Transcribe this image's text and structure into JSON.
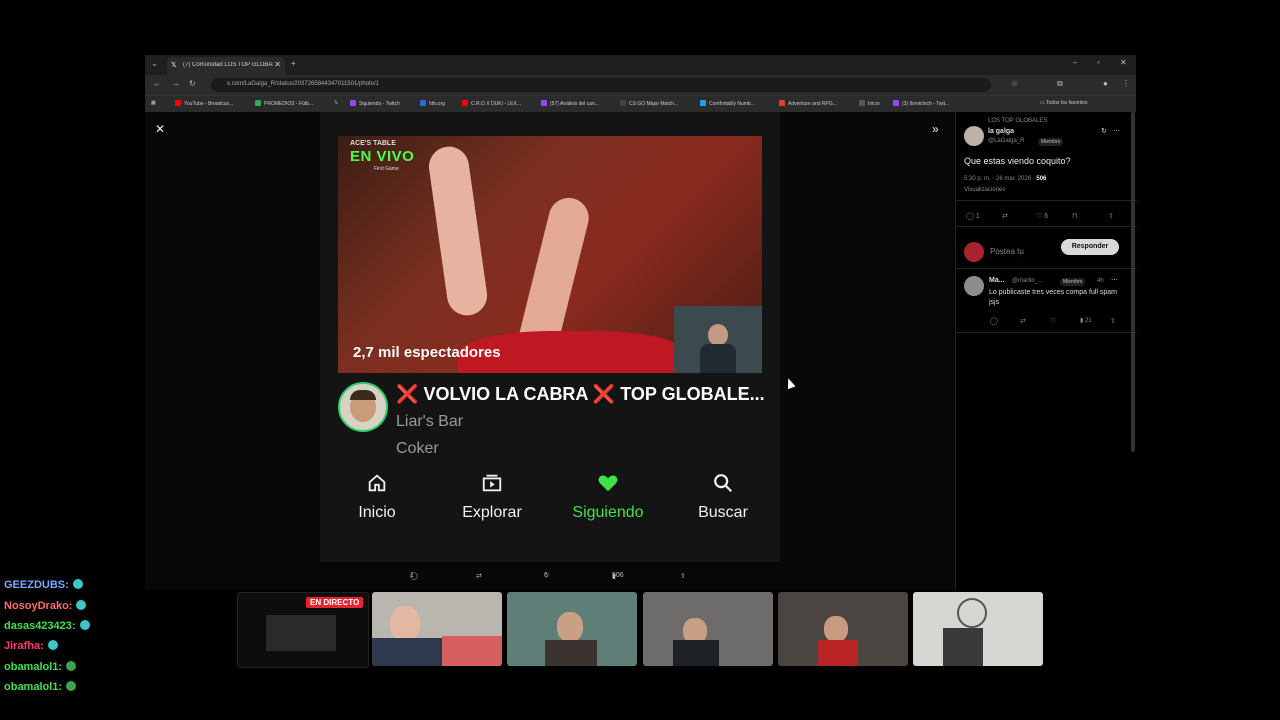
{
  "browser": {
    "tab_title": "(7) Comunidad LOS TOP GLOBALES",
    "url": "x.com/LaGalga_R/status/2037265844347011501/photo/1",
    "window_controls": [
      "–",
      "▫",
      "✕"
    ],
    "bookmarks": [
      {
        "label": "YouTube - Broadcas...",
        "color": "#ff0000"
      },
      {
        "label": "PROMEDIOS - Fútb...",
        "color": "#34a853"
      },
      {
        "label": "𝕏",
        "color": "#000000"
      },
      {
        "label": "Siguiendo - Twitch",
        "color": "#9146ff"
      },
      {
        "label": "hltv.org",
        "color": "#2d6bd6"
      },
      {
        "label": "C.R.O X DUKI - LEX...",
        "color": "#ff0000"
      },
      {
        "label": "(57) Análisis del can...",
        "color": "#9146ff"
      },
      {
        "label": "CS:GO Major Match...",
        "color": "#444444"
      },
      {
        "label": "Comfortably Numb...",
        "color": "#1da1f2"
      },
      {
        "label": "Adventure and RPG...",
        "color": "#e63b2e"
      },
      {
        "label": "Inicio",
        "color": "#000000"
      },
      {
        "label": "(3) Ilorvichich - Twit...",
        "color": "#9146ff"
      }
    ],
    "all_bookmarks": "Todos los favoritos"
  },
  "modal": {
    "close_icon": "✕",
    "next_icon": "»"
  },
  "stream_card": {
    "overlay_title": "ACE'S TABLE",
    "overlay_sub": "First Game",
    "live_label": "EN VIVO",
    "viewers": "2,7 mil espectadores",
    "title_x": "❌",
    "title_text": "VOLVIO LA CABRA",
    "title_text2": "TOP GLOBALE...",
    "game": "Liar's Bar",
    "streamer": "Coker",
    "nav": [
      {
        "label": "Inicio",
        "icon": "home-icon"
      },
      {
        "label": "Explorar",
        "icon": "browse-icon"
      },
      {
        "label": "Siguiendo",
        "icon": "heart-icon"
      },
      {
        "label": "Buscar",
        "icon": "search-icon"
      }
    ],
    "accent": "#3ee24a"
  },
  "tweet_bar": {
    "replies": "1",
    "likes": "6",
    "views": "506"
  },
  "right_panel": {
    "community": "LOS TOP GLOBALES",
    "author_name": "la galga",
    "author_handle": "@LaGalga_R",
    "member_badge": "Miembro",
    "tweet_text": "Que estas viendo coquito?",
    "timestamp": "5:30 p. m. · 26 mar. 2026 ·",
    "views_count": "506",
    "views_label": "Visualizaciones",
    "action_replies": "1",
    "action_likes": "6",
    "reply_placeholder": "Postea tu respuesta",
    "reply_button": "Responder",
    "reply": {
      "name": "Ma...",
      "handle": "@martin_...",
      "badge": "Miembro",
      "time": "4h",
      "text": "Lo publicaste tres veces compa full spam jsjs",
      "views": "21"
    }
  },
  "stream_overlay": {
    "live_badge": "EN DIRECTO"
  },
  "chat": [
    {
      "user": "GEEZDUBS:",
      "color": "#7aa7ff",
      "badge": "#3ec7c7"
    },
    {
      "user": "NosoyDrako:",
      "color": "#ff6a6a",
      "badge": "#3ec7c7"
    },
    {
      "user": "dasas423423:",
      "color": "#3ee24a",
      "badge": "#3ec7c7"
    },
    {
      "user": "Jirafha:",
      "color": "#ff3b6b",
      "badge": "#3ec7c7"
    },
    {
      "user": "obamalol1:",
      "color": "#3ee24a",
      "badge": "#3ea34a"
    },
    {
      "user": "obamalol1:",
      "color": "#3ee24a",
      "badge": "#3ea34a"
    }
  ]
}
